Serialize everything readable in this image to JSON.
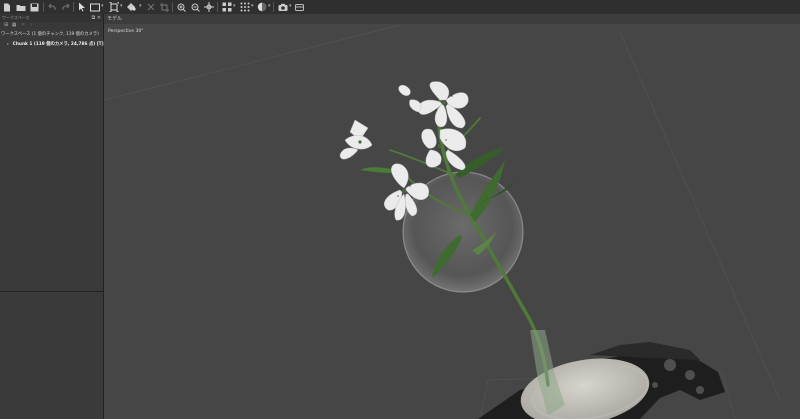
{
  "app": {
    "toolbar_icons": [
      "new-file-icon",
      "open-folder-icon",
      "save-icon",
      "undo-icon",
      "redo-icon",
      "navigation-pointer-icon",
      "rectangle-selection-icon",
      "resize-region-icon",
      "move-region-icon",
      "delete-icon",
      "crop-icon",
      "zoom-in-icon",
      "zoom-out-icon",
      "move-object-icon",
      "view-toggle-icon",
      "grid-icon",
      "shading-icon",
      "camera-icon",
      "settings-icon"
    ]
  },
  "workspace": {
    "title": "ワークスペース",
    "root_label": "ワークスペース (1 個のチャンク, 119 個のカメラ)",
    "chunk_label": "Chunk 1 (119 個のカメラ, 24,786 点) [T]"
  },
  "model": {
    "tab_label": "モデル",
    "viewport_label": "Perspective 30°"
  },
  "colors": {
    "toolbar_bg": "#2f2f2f",
    "panel_bg": "#3a3a3a",
    "viewport_bg": "#464646",
    "petal": "#e9e9e9",
    "stem": "#4f7a3a"
  }
}
